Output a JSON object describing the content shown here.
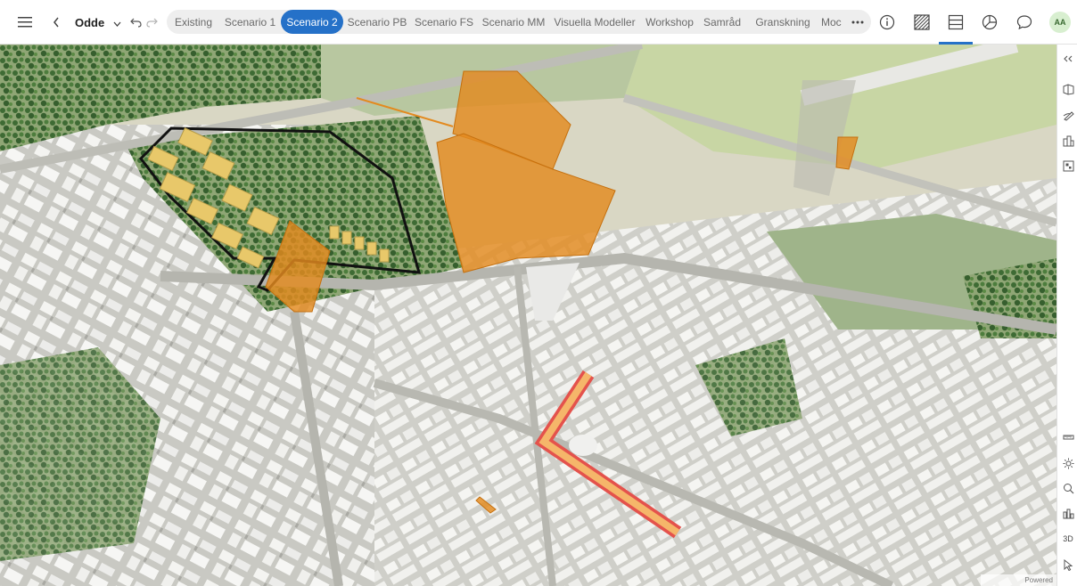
{
  "header": {
    "project_name": "Odde",
    "tabs": [
      {
        "label": "Existing",
        "active": false
      },
      {
        "label": "Scenario 1",
        "active": false
      },
      {
        "label": "Scenario 2",
        "active": true
      },
      {
        "label": "Scenario PB",
        "active": false
      },
      {
        "label": "Scenario FS",
        "active": false
      },
      {
        "label": "Scenario MM",
        "active": false
      },
      {
        "label": "Visuella Modeller",
        "active": false
      },
      {
        "label": "Workshop",
        "active": false
      },
      {
        "label": "Samråd",
        "active": false
      },
      {
        "label": "Granskning",
        "active": false
      },
      {
        "label": "Moc",
        "active": false
      }
    ],
    "more_label": "···",
    "avatar_initials": "AA",
    "accent_color": "#2571c8"
  },
  "right_rail": {
    "view_mode_label": "3D"
  },
  "map": {
    "attribution": "Powered"
  }
}
